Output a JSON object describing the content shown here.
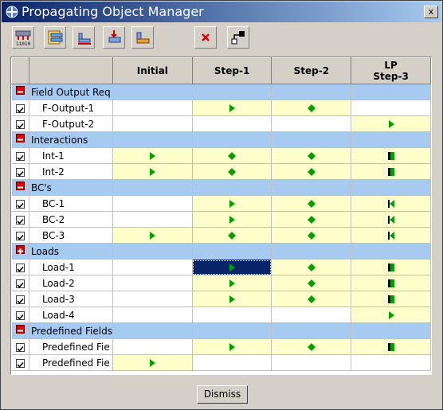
{
  "window": {
    "title": "Propagating Object Manager",
    "close_label": "x"
  },
  "toolbar": {
    "icons": [
      "step-sequence-icon",
      "field-output-icon",
      "bc-icon",
      "load-icon",
      "predefined-field-icon",
      "delete-icon",
      "rename-icon"
    ]
  },
  "columns": [
    "Initial",
    "Step-1",
    "Step-2",
    "LP\nStep-3"
  ],
  "groups": [
    {
      "label": "Field Output Req",
      "expanded": true,
      "rows": [
        {
          "name": "F-Output-1",
          "checked": true,
          "cells": [
            "w:",
            "y:arrow",
            "y:diamond",
            "w:"
          ]
        },
        {
          "name": "F-Output-2",
          "checked": true,
          "cells": [
            "w:",
            "w:",
            "w:",
            "y:arrow"
          ]
        }
      ]
    },
    {
      "label": "Interactions",
      "expanded": true,
      "rows": [
        {
          "name": "Int-1",
          "checked": true,
          "cells": [
            "y:arrow",
            "y:diamond",
            "y:diamond",
            "y:bar"
          ]
        },
        {
          "name": "Int-2",
          "checked": true,
          "cells": [
            "y:arrow",
            "y:diamond",
            "y:diamond",
            "y:bar"
          ]
        }
      ]
    },
    {
      "label": "BC's",
      "expanded": true,
      "rows": [
        {
          "name": "BC-1",
          "checked": true,
          "cells": [
            "w:",
            "y:arrow",
            "y:diamond",
            "y:back"
          ]
        },
        {
          "name": "BC-2",
          "checked": true,
          "cells": [
            "w:",
            "y:arrow",
            "y:diamond",
            "y:back"
          ]
        },
        {
          "name": "BC-3",
          "checked": true,
          "cells": [
            "y:arrow",
            "y:diamond",
            "y:diamond",
            "y:back"
          ]
        }
      ]
    },
    {
      "label": "Loads",
      "expanded": false,
      "rows": [
        {
          "name": "Load-1",
          "checked": true,
          "cells": [
            "w:",
            "sel:arrow",
            "y:diamond",
            "y:bar"
          ]
        },
        {
          "name": "Load-2",
          "checked": true,
          "cells": [
            "w:",
            "y:arrow",
            "y:diamond",
            "y:bar"
          ]
        },
        {
          "name": "Load-3",
          "checked": true,
          "cells": [
            "w:",
            "y:arrow",
            "y:diamond",
            "y:bar"
          ]
        },
        {
          "name": "Load-4",
          "checked": true,
          "cells": [
            "w:",
            "w:",
            "w:",
            "y:arrow"
          ]
        }
      ]
    },
    {
      "label": "Predefined Fields",
      "expanded": true,
      "rows": [
        {
          "name": "Predefined Fie",
          "checked": true,
          "cells": [
            "w:",
            "y:arrow",
            "y:diamond",
            "y:bar"
          ]
        },
        {
          "name": "Predefined Fie",
          "checked": true,
          "cells": [
            "y:arrow",
            "w:",
            "w:",
            "w:"
          ]
        }
      ]
    }
  ],
  "dismiss_label": "Dismiss",
  "colors": {
    "title_start": "#0a246a",
    "title_end": "#a6caf0",
    "group_row": "#a6caf0",
    "active_cell": "#ffffcc",
    "marker": "#00a000",
    "selected": "#0a246a"
  }
}
